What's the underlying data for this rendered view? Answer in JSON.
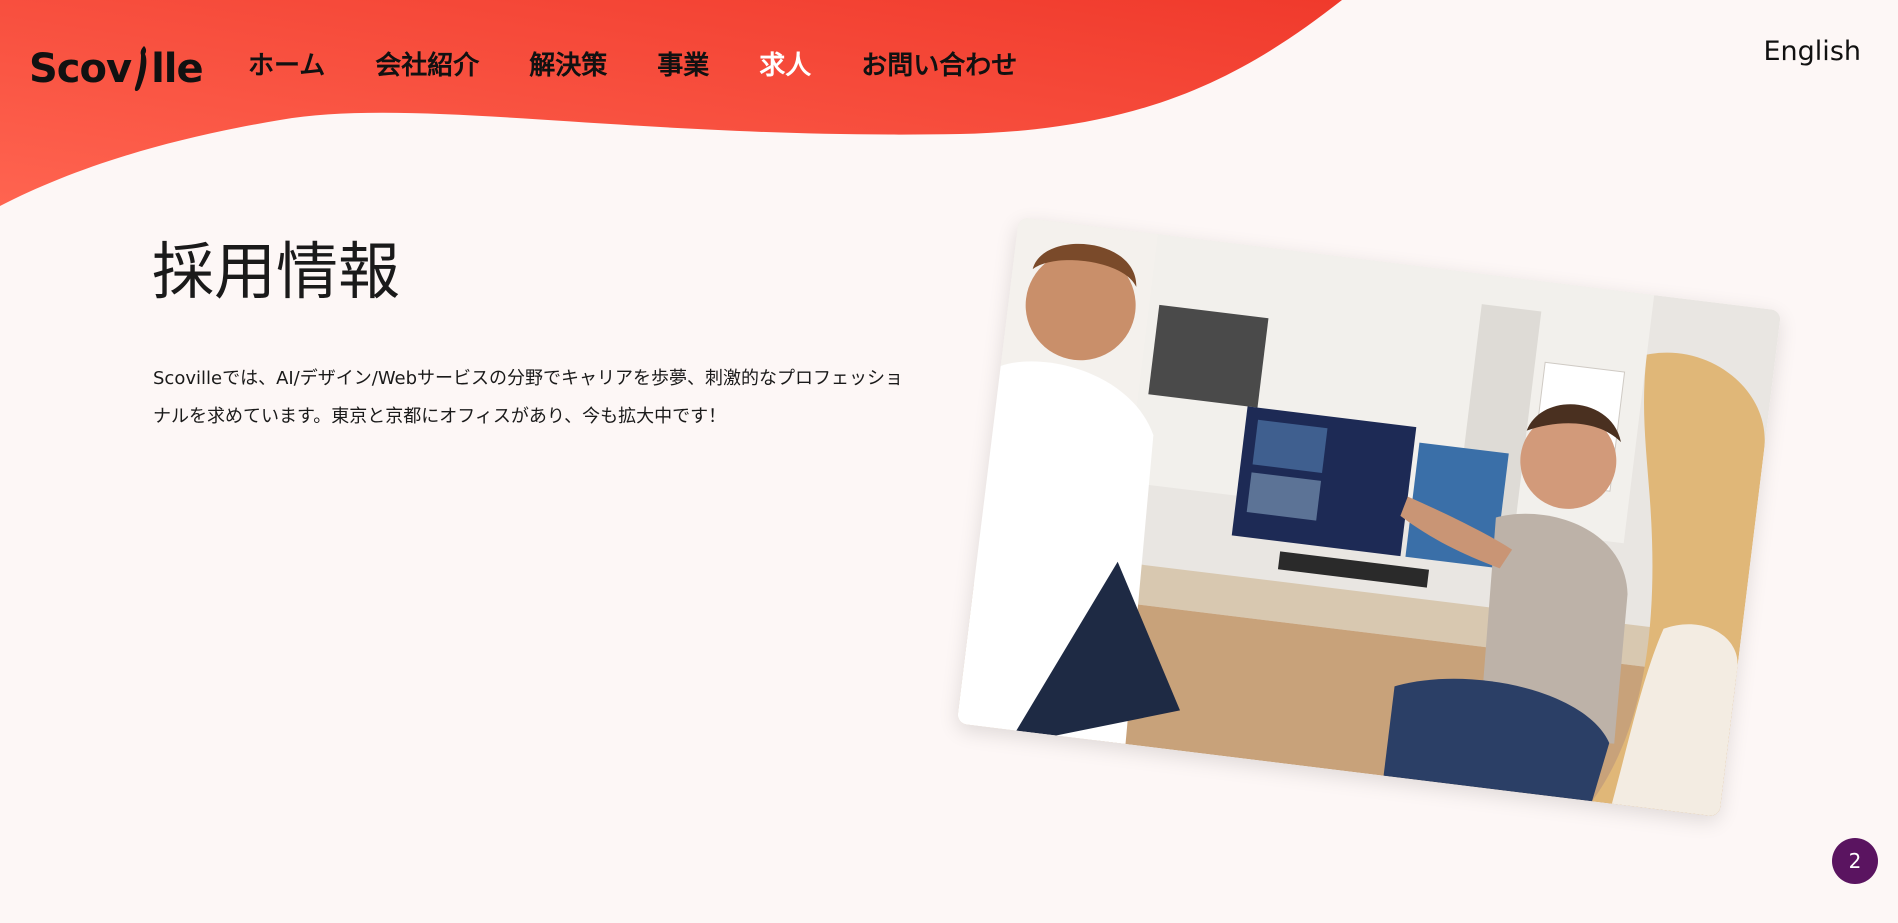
{
  "brand": {
    "logo_text_left": "Scov",
    "logo_text_right": "lle",
    "primary_color": "#f2402f",
    "secondary_color": "#ff6450"
  },
  "nav": {
    "items": [
      {
        "label": "ホーム",
        "active": false
      },
      {
        "label": "会社紹介",
        "active": false
      },
      {
        "label": "解決策",
        "active": false
      },
      {
        "label": "事業",
        "active": false
      },
      {
        "label": "求人",
        "active": true
      },
      {
        "label": "お問い合わせ",
        "active": false
      }
    ],
    "language_link": "English"
  },
  "main": {
    "title": "採用情報",
    "intro": "Scovilleでは、AI/デザイン/Webサービスの分野でキャリアを歩夢、刺激的なプロフェッショナルを求めています。東京と京都にオフィスがあり、今も拡大中です！"
  },
  "badge": {
    "count": "2",
    "color": "#5a1460"
  }
}
